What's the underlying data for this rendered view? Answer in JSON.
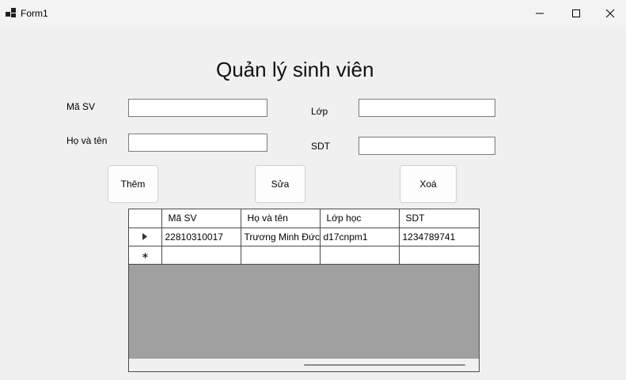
{
  "window": {
    "title": "Form1"
  },
  "icons": {
    "app": "app-icon",
    "minimize": "minimize-icon",
    "maximize": "maximize-icon",
    "close": "close-icon",
    "current_row": "current-row-arrow-icon",
    "new_row": "new-row-asterisk-icon"
  },
  "form": {
    "heading": "Quản lý sinh viên",
    "fields": {
      "ma_sv": {
        "label": "Mã SV",
        "value": ""
      },
      "ho_ten": {
        "label": "Họ và tên",
        "value": ""
      },
      "lop": {
        "label": "Lớp",
        "value": ""
      },
      "sdt": {
        "label": "SDT",
        "value": ""
      }
    },
    "buttons": {
      "add": "Thêm",
      "edit": "Sửa",
      "delete": "Xoá"
    }
  },
  "grid": {
    "columns": [
      "Mã SV",
      "Họ và tên",
      "Lớp học",
      "SDT"
    ],
    "rows": [
      [
        "22810310017",
        "Trương Minh Đức",
        "d17cnpm1",
        "1234789741"
      ]
    ]
  }
}
